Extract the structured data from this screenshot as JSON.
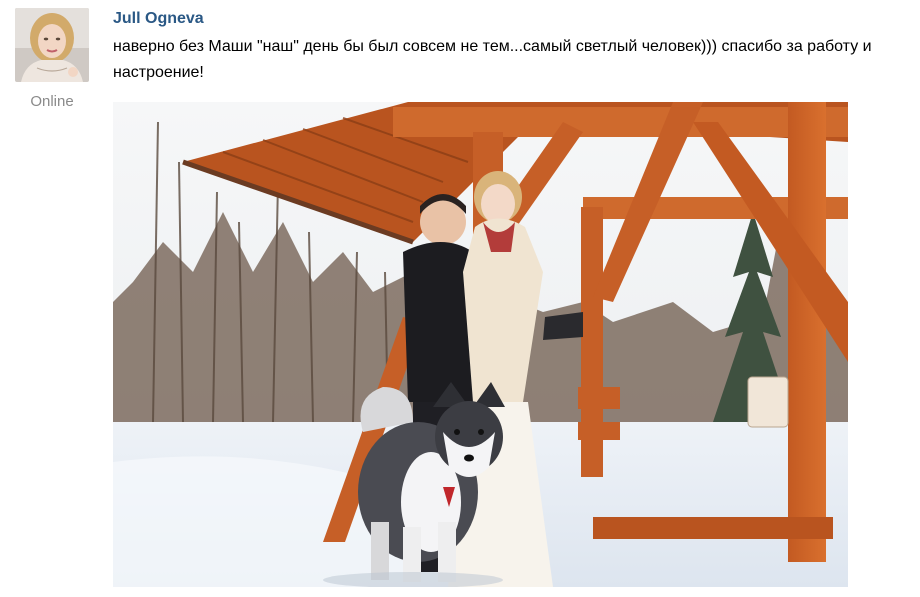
{
  "post": {
    "author": "Jull Ogneva",
    "status": "Online",
    "message": "наверно без Маши \"наш\" день бы был совсем не тем...самый светлый человек))) спасибо за работу и настроение!",
    "avatar_icon": "user-avatar-photo",
    "photo_icon": "wedding-photo-gazebo-husky"
  }
}
